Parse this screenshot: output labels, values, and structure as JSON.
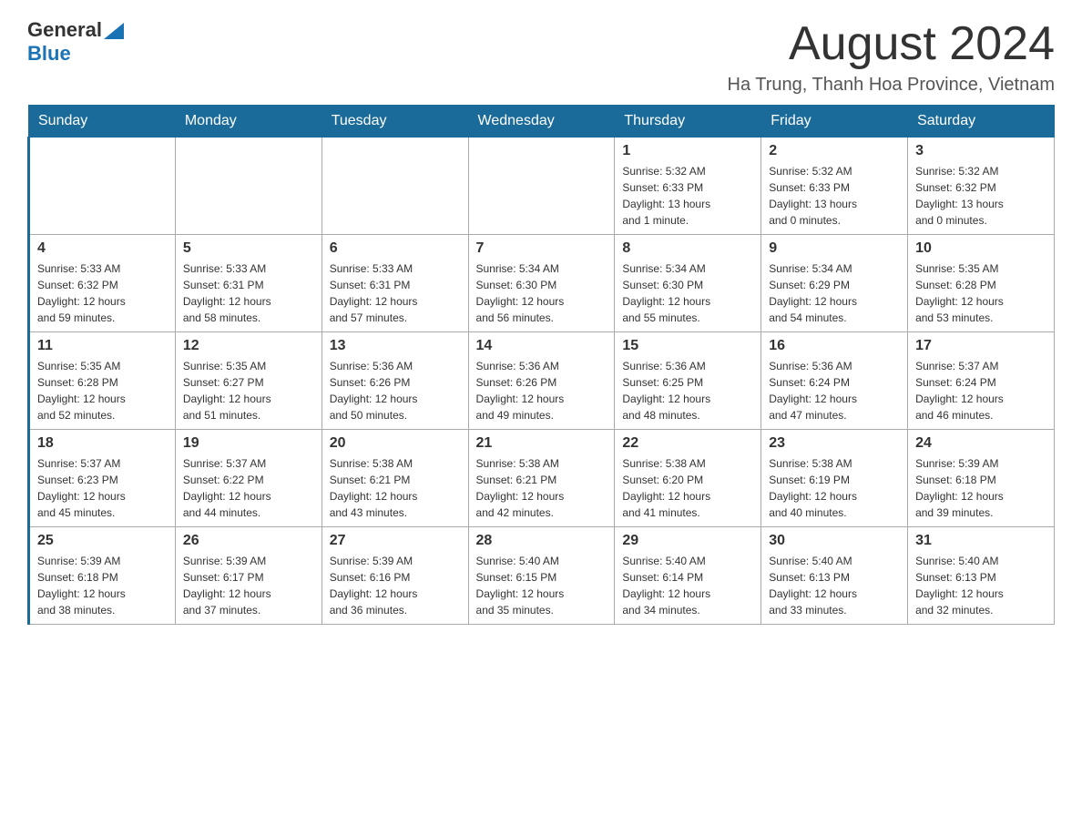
{
  "header": {
    "logo_general": "General",
    "logo_blue": "Blue",
    "month_title": "August 2024",
    "location": "Ha Trung, Thanh Hoa Province, Vietnam"
  },
  "calendar": {
    "days_of_week": [
      "Sunday",
      "Monday",
      "Tuesday",
      "Wednesday",
      "Thursday",
      "Friday",
      "Saturday"
    ],
    "weeks": [
      {
        "days": [
          {
            "num": "",
            "info": ""
          },
          {
            "num": "",
            "info": ""
          },
          {
            "num": "",
            "info": ""
          },
          {
            "num": "",
            "info": ""
          },
          {
            "num": "1",
            "info": "Sunrise: 5:32 AM\nSunset: 6:33 PM\nDaylight: 13 hours\nand 1 minute."
          },
          {
            "num": "2",
            "info": "Sunrise: 5:32 AM\nSunset: 6:33 PM\nDaylight: 13 hours\nand 0 minutes."
          },
          {
            "num": "3",
            "info": "Sunrise: 5:32 AM\nSunset: 6:32 PM\nDaylight: 13 hours\nand 0 minutes."
          }
        ]
      },
      {
        "days": [
          {
            "num": "4",
            "info": "Sunrise: 5:33 AM\nSunset: 6:32 PM\nDaylight: 12 hours\nand 59 minutes."
          },
          {
            "num": "5",
            "info": "Sunrise: 5:33 AM\nSunset: 6:31 PM\nDaylight: 12 hours\nand 58 minutes."
          },
          {
            "num": "6",
            "info": "Sunrise: 5:33 AM\nSunset: 6:31 PM\nDaylight: 12 hours\nand 57 minutes."
          },
          {
            "num": "7",
            "info": "Sunrise: 5:34 AM\nSunset: 6:30 PM\nDaylight: 12 hours\nand 56 minutes."
          },
          {
            "num": "8",
            "info": "Sunrise: 5:34 AM\nSunset: 6:30 PM\nDaylight: 12 hours\nand 55 minutes."
          },
          {
            "num": "9",
            "info": "Sunrise: 5:34 AM\nSunset: 6:29 PM\nDaylight: 12 hours\nand 54 minutes."
          },
          {
            "num": "10",
            "info": "Sunrise: 5:35 AM\nSunset: 6:28 PM\nDaylight: 12 hours\nand 53 minutes."
          }
        ]
      },
      {
        "days": [
          {
            "num": "11",
            "info": "Sunrise: 5:35 AM\nSunset: 6:28 PM\nDaylight: 12 hours\nand 52 minutes."
          },
          {
            "num": "12",
            "info": "Sunrise: 5:35 AM\nSunset: 6:27 PM\nDaylight: 12 hours\nand 51 minutes."
          },
          {
            "num": "13",
            "info": "Sunrise: 5:36 AM\nSunset: 6:26 PM\nDaylight: 12 hours\nand 50 minutes."
          },
          {
            "num": "14",
            "info": "Sunrise: 5:36 AM\nSunset: 6:26 PM\nDaylight: 12 hours\nand 49 minutes."
          },
          {
            "num": "15",
            "info": "Sunrise: 5:36 AM\nSunset: 6:25 PM\nDaylight: 12 hours\nand 48 minutes."
          },
          {
            "num": "16",
            "info": "Sunrise: 5:36 AM\nSunset: 6:24 PM\nDaylight: 12 hours\nand 47 minutes."
          },
          {
            "num": "17",
            "info": "Sunrise: 5:37 AM\nSunset: 6:24 PM\nDaylight: 12 hours\nand 46 minutes."
          }
        ]
      },
      {
        "days": [
          {
            "num": "18",
            "info": "Sunrise: 5:37 AM\nSunset: 6:23 PM\nDaylight: 12 hours\nand 45 minutes."
          },
          {
            "num": "19",
            "info": "Sunrise: 5:37 AM\nSunset: 6:22 PM\nDaylight: 12 hours\nand 44 minutes."
          },
          {
            "num": "20",
            "info": "Sunrise: 5:38 AM\nSunset: 6:21 PM\nDaylight: 12 hours\nand 43 minutes."
          },
          {
            "num": "21",
            "info": "Sunrise: 5:38 AM\nSunset: 6:21 PM\nDaylight: 12 hours\nand 42 minutes."
          },
          {
            "num": "22",
            "info": "Sunrise: 5:38 AM\nSunset: 6:20 PM\nDaylight: 12 hours\nand 41 minutes."
          },
          {
            "num": "23",
            "info": "Sunrise: 5:38 AM\nSunset: 6:19 PM\nDaylight: 12 hours\nand 40 minutes."
          },
          {
            "num": "24",
            "info": "Sunrise: 5:39 AM\nSunset: 6:18 PM\nDaylight: 12 hours\nand 39 minutes."
          }
        ]
      },
      {
        "days": [
          {
            "num": "25",
            "info": "Sunrise: 5:39 AM\nSunset: 6:18 PM\nDaylight: 12 hours\nand 38 minutes."
          },
          {
            "num": "26",
            "info": "Sunrise: 5:39 AM\nSunset: 6:17 PM\nDaylight: 12 hours\nand 37 minutes."
          },
          {
            "num": "27",
            "info": "Sunrise: 5:39 AM\nSunset: 6:16 PM\nDaylight: 12 hours\nand 36 minutes."
          },
          {
            "num": "28",
            "info": "Sunrise: 5:40 AM\nSunset: 6:15 PM\nDaylight: 12 hours\nand 35 minutes."
          },
          {
            "num": "29",
            "info": "Sunrise: 5:40 AM\nSunset: 6:14 PM\nDaylight: 12 hours\nand 34 minutes."
          },
          {
            "num": "30",
            "info": "Sunrise: 5:40 AM\nSunset: 6:13 PM\nDaylight: 12 hours\nand 33 minutes."
          },
          {
            "num": "31",
            "info": "Sunrise: 5:40 AM\nSunset: 6:13 PM\nDaylight: 12 hours\nand 32 minutes."
          }
        ]
      }
    ]
  }
}
